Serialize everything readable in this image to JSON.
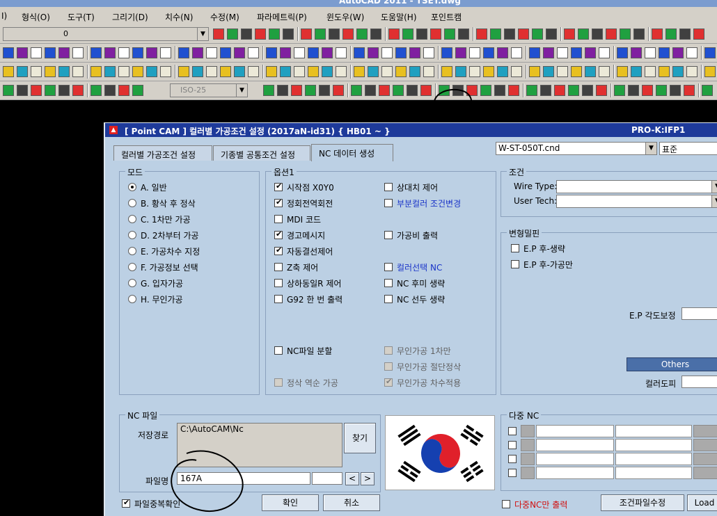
{
  "app": {
    "title": "AutoCAD 2011 - TSET.dwg"
  },
  "menu": [
    "I)",
    "형식(O)",
    "도구(T)",
    "그리기(D)",
    "치수(N)",
    "수정(M)",
    "파라메트릭(P)",
    "윈도우(W)",
    "도움말(H)",
    "포인트캠"
  ],
  "toolbar": {
    "layer_value": "0",
    "dimstyle_value": "ISO-25"
  },
  "dialog": {
    "title": "[ Point CAM ]  컬러별 가공조건 설정  (2017aN-id31)  { HB01 ~ }",
    "right_title": "PRO-K:IFP1",
    "tabs": [
      "컬러별 가공조건 설정",
      "기종별 공통조건 설정",
      "NC 데이터 생성"
    ],
    "machine_combo": "W-ST-050T.cnd",
    "standard_combo": "표준",
    "mode": {
      "label": "모드",
      "options": [
        {
          "text": "A. 일반",
          "checked": true
        },
        {
          "text": "B. 황삭 후 정삭",
          "checked": false
        },
        {
          "text": "C. 1차만 가공",
          "checked": false
        },
        {
          "text": "D. 2차부터 가공",
          "checked": false
        },
        {
          "text": "E. 가공차수 지정",
          "checked": false
        },
        {
          "text": "F. 가공정보 선택",
          "checked": false
        },
        {
          "text": "G. 입자가공",
          "checked": false
        },
        {
          "text": "H. 무인가공",
          "checked": false
        }
      ]
    },
    "option1": {
      "label": "옵션1",
      "left": [
        {
          "text": "시작점 X0Y0",
          "checked": true
        },
        {
          "text": "정회전역회전",
          "checked": true
        },
        {
          "text": "MDI 코드",
          "checked": false
        },
        {
          "text": "경고메시지",
          "checked": true
        },
        {
          "text": "자동결선제어",
          "checked": true
        },
        {
          "text": "Z축 제어",
          "checked": false
        },
        {
          "text": "상하동일R 제어",
          "checked": false
        },
        {
          "text": "G92 한 번 출력",
          "checked": false
        }
      ],
      "right": [
        {
          "text": "상대치 제어",
          "checked": false
        },
        {
          "text": "부분컬러 조건변경",
          "checked": false
        },
        {
          "text": "가공비 출력",
          "checked": false
        },
        {
          "text": "컬러선택 NC",
          "checked": false
        },
        {
          "text": "NC 후미 생략",
          "checked": false
        },
        {
          "text": "NC 선두 생략",
          "checked": false
        }
      ],
      "nc_split": "NC파일 분할",
      "reverse": "정삭 역순 가공",
      "unmanned1": "무인가공 1차만",
      "unmanned2": "무인가공 절단정삭",
      "unmanned3": "무인가공 차수적용"
    },
    "condition": {
      "label": "조건",
      "wire_type": "Wire Type:",
      "user_tech": "User Tech:"
    },
    "deform": {
      "label": "변형밀핀",
      "ep_skip": "E.P 후-생략",
      "ep_only": "E.P 후-가공만",
      "ep_angle": "E.P 각도보정",
      "others": "Others",
      "color_paper": "컬러도피"
    },
    "ncfile": {
      "label": "NC 파일",
      "save_path_label": "저장경로",
      "save_path": "C:\\AutoCAM\\Nc",
      "find_button": "찾기",
      "filename_label": "파일명",
      "filename": "167A",
      "prev": "<",
      "next": ">"
    },
    "multi_nc": {
      "label": "다중 NC",
      "only_output": "다중NC만 출력"
    },
    "bottom": {
      "dup_check": "파일중복확인",
      "ok": "확인",
      "cancel": "취소",
      "edit_cond": "조건파일수정",
      "load": "Load"
    }
  }
}
